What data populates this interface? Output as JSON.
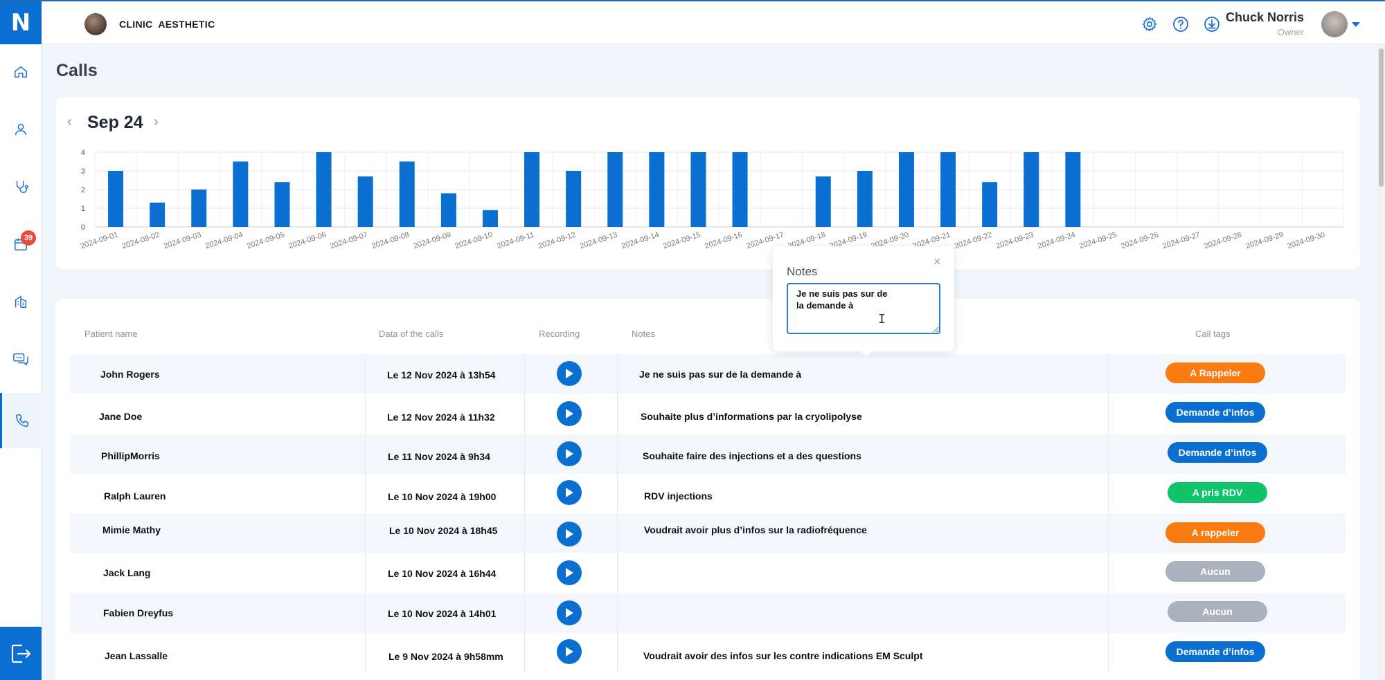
{
  "app": {
    "logo": "N",
    "clinic_name": "CLINIC  AESTHETIC"
  },
  "header": {
    "icons": [
      "gear-icon",
      "help-icon",
      "download-icon"
    ],
    "user": {
      "name": "Chuck Norris",
      "role": "Owner"
    }
  },
  "sidebar": {
    "items": [
      {
        "name": "home",
        "icon": "home-icon"
      },
      {
        "name": "patients",
        "icon": "user-icon"
      },
      {
        "name": "treatments",
        "icon": "stethoscope-icon"
      },
      {
        "name": "calendar",
        "icon": "calendar-icon",
        "badge": "39"
      },
      {
        "name": "clinic",
        "icon": "building-icon"
      },
      {
        "name": "messages",
        "icon": "chat-icon"
      },
      {
        "name": "calls",
        "icon": "phone-icon",
        "active": true
      }
    ],
    "logout_icon": "logout-icon"
  },
  "page": {
    "title": "Calls"
  },
  "chart_nav": {
    "prev": "‹",
    "month": "Sep 24",
    "next": "›"
  },
  "chart_data": {
    "type": "bar",
    "ylim": [
      0,
      4
    ],
    "yticks": [
      "0",
      "1",
      "2",
      "3",
      "4"
    ],
    "grid": true,
    "color": "#0a6fd1",
    "categories": [
      "2024-09-01",
      "2024-09-02",
      "2024-09-03",
      "2024-09-04",
      "2024-09-05",
      "2024-09-06",
      "2024-09-07",
      "2024-09-08",
      "2024-09-09",
      "2024-09-10",
      "2024-09-11",
      "2024-09-12",
      "2024-09-13",
      "2024-09-14",
      "2024-09-15",
      "2024-09-16",
      "2024-09-17",
      "2024-09-18",
      "2024-09-19",
      "2024-09-20",
      "2024-09-21",
      "2024-09-22",
      "2024-09-23",
      "2024-09-24",
      "2024-09-25",
      "2024-09-26",
      "2024-09-27",
      "2024-09-28",
      "2024-09-29",
      "2024-09-30"
    ],
    "values": [
      3,
      1.3,
      2,
      3.5,
      2.4,
      4,
      2.7,
      3.5,
      1.8,
      0.9,
      4,
      3,
      4,
      4,
      4,
      4,
      0,
      2.7,
      3,
      4,
      4,
      2.4,
      4,
      4,
      0,
      0,
      0,
      0,
      0,
      0
    ]
  },
  "table": {
    "headers": {
      "patient": "Patient name",
      "date": "Data of the calls",
      "recording": "Recording",
      "notes": "Notes",
      "tags": "Call tags"
    },
    "rows": [
      {
        "patient": "John Rogers",
        "date": "Le 12 Nov 2024 à 13h54",
        "notes": "Je ne suis pas sur de la demande à",
        "tag": "A Rappeler",
        "tag_color": "#f97b12"
      },
      {
        "patient": "Jane Doe",
        "date": "Le 12 Nov 2024 à 11h32",
        "notes": "Souhaite plus d’informations par la cryolipolyse",
        "tag": "Demande d’infos",
        "tag_color": "#0a6fd1"
      },
      {
        "patient": "PhillipMorris",
        "date": "Le 11 Nov 2024 à 9h34",
        "notes": "Souhaite faire des injections et a des questions",
        "tag": "Demande d’infos",
        "tag_color": "#0a6fd1"
      },
      {
        "patient": "Ralph Lauren",
        "date": "Le 10 Nov 2024 à 19h00",
        "notes": "RDV injections",
        "tag": "A pris RDV",
        "tag_color": "#10c46a"
      },
      {
        "patient": "Mimie Mathy",
        "date": "Le 10 Nov 2024 à 18h45",
        "notes": "Voudrait avoir plus d’infos sur la radiofréquence",
        "tag": "A rappeler",
        "tag_color": "#f97b12"
      },
      {
        "patient": "Jack Lang",
        "date": "Le 10 Nov 2024 à 16h44",
        "notes": "",
        "tag": "Aucun",
        "tag_color": "#aab2bd"
      },
      {
        "patient": "Fabien Dreyfus",
        "date": "Le 10 Nov 2024 à 14h01",
        "notes": "",
        "tag": "Aucun",
        "tag_color": "#aab2bd"
      },
      {
        "patient": "Jean Lassalle",
        "date": "Le 9 Nov 2024 à 9h58mm",
        "notes": "Voudrait avoir des infos sur les contre indications  EM Sculpt",
        "tag": "Demande d’infos",
        "tag_color": "#0a6fd1"
      }
    ]
  },
  "notes_popover": {
    "title": "Notes",
    "close": "×",
    "value": "Je ne suis pas sur de\nla demande à"
  }
}
